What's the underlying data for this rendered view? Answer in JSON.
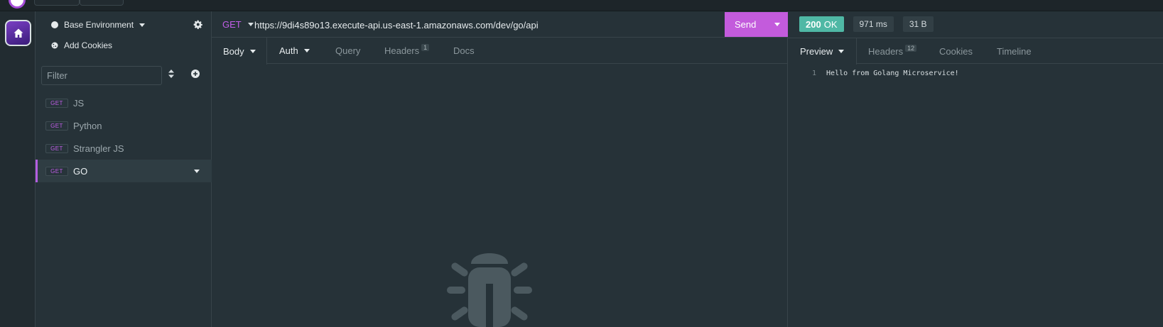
{
  "sidebar": {
    "environment_label": "Base Environment",
    "cookies_label": "Add Cookies",
    "filter_placeholder": "Filter",
    "requests": [
      {
        "method": "GET",
        "name": "JS"
      },
      {
        "method": "GET",
        "name": "Python"
      },
      {
        "method": "GET",
        "name": "Strangler JS"
      },
      {
        "method": "GET",
        "name": "GO"
      }
    ]
  },
  "request": {
    "method": "GET",
    "url": "https://9di4s89o13.execute-api.us-east-1.amazonaws.com/dev/go/api",
    "send_label": "Send",
    "tabs": {
      "body": "Body",
      "auth": "Auth",
      "query": "Query",
      "headers": "Headers",
      "headers_count": "1",
      "docs": "Docs"
    }
  },
  "response": {
    "status_code": "200",
    "status_text": "OK",
    "time": "971 ms",
    "size": "31 B",
    "tabs": {
      "preview": "Preview",
      "headers": "Headers",
      "headers_count": "12",
      "cookies": "Cookies",
      "timeline": "Timeline"
    },
    "line_number": "1",
    "body_text": "Hello from Golang Microservice!"
  },
  "colors": {
    "accent": "#c35bdc",
    "status_ok": "#4fb8a5",
    "background": "#263238"
  }
}
